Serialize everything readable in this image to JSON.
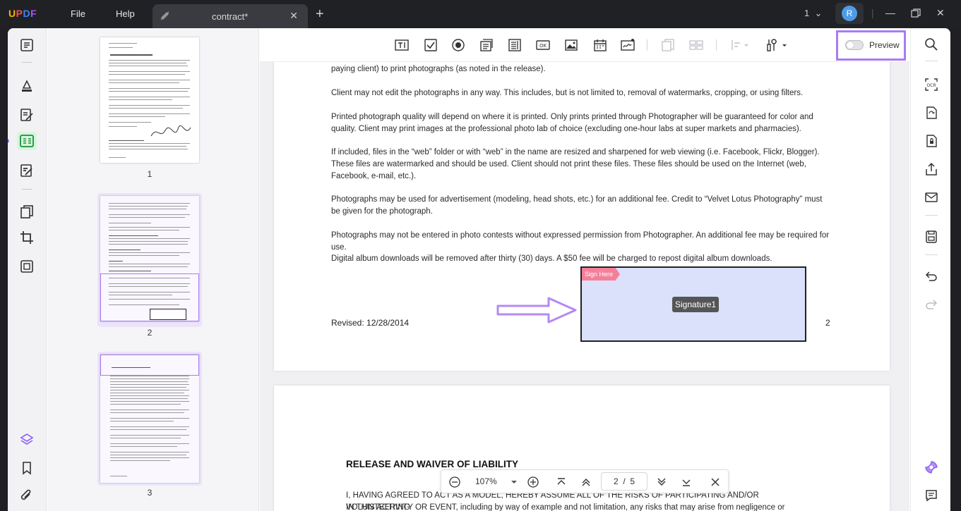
{
  "app": {
    "logo": [
      "U",
      "P",
      "D",
      "F"
    ]
  },
  "menu": {
    "file": "File",
    "help": "Help"
  },
  "tab": {
    "title": "contract*"
  },
  "window": {
    "page_count": "1",
    "avatar_initial": "R"
  },
  "toolbar": {
    "preview_label": "Preview"
  },
  "thumbnails": [
    {
      "label": "1"
    },
    {
      "label": "2"
    },
    {
      "label": "3"
    }
  ],
  "page1": {
    "paragraphs": [
      "paying client) to print photographs (as noted in the release).",
      "Client may not edit the photographs in any way. This includes, but is not limited to, removal of watermarks, cropping, or using filters.",
      "Printed photograph quality will depend on where it is printed. Only prints printed through Photographer will be guaranteed for color and quality. Client may print images at the professional photo lab of choice (excluding one-hour labs at super markets and pharmacies).",
      "If included, files in the “web” folder or with “web” in the name are resized and sharpened for web viewing (i.e. Facebook, Flickr, Blogger). These files are watermarked and should be used. Client should not print these files. These files should be used on the Internet (web, Facebook, e-mail, etc.).",
      "Photographs may be used for advertisement (modeling, head shots, etc.) for an additional fee. Credit to “Velvet Lotus Photography” must be given for the photograph.",
      "Photographs may not be entered in photo contests without expressed permission from Photographer. An additional fee may be required for use.",
      "Digital album downloads will be removed after thirty (30) days. A $50 fee will be charged to repost digital album downloads."
    ],
    "sign_here": "Sign Here",
    "signature_field": "Signature1",
    "revised": "Revised: 12/28/2014",
    "page_number": "2"
  },
  "page2": {
    "heading": "RELEASE AND WAIVER OF LIABILITY",
    "line1": "I, HAVING AGREED TO ACT AS A MODEL, HEREBY ASSUME ALL OF THE RISKS OF PARTICIPATING AND/OR VOLUNTEERING",
    "line2": "IN THIS ACTIVITY OR EVENT, including by way of example and not limitation, any risks that may arise from negligence or"
  },
  "navbar": {
    "zoom": "107%",
    "current_page": "2",
    "separator": "/",
    "total_pages": "5"
  },
  "colors": {
    "accent": "#a97bf0",
    "sign_here": "#f47f99",
    "signature_fill": "#dbe0fb",
    "rail_active": "#d6f5dd"
  }
}
